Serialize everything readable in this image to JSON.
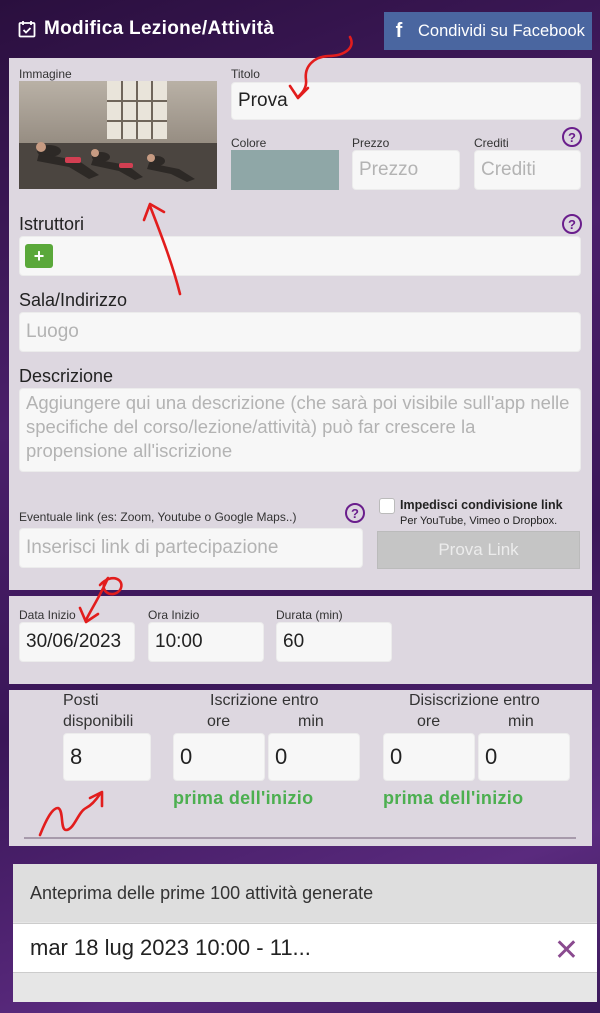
{
  "header": {
    "title": "Modifica Lezione/Attività",
    "facebook_button": "Condividi su Facebook",
    "facebook_glyph": "f"
  },
  "form": {
    "image_label": "Immagine",
    "title_label": "Titolo",
    "title_value": "Prova",
    "color_label": "Colore",
    "color_value": "#8fa7a7",
    "price_label": "Prezzo",
    "price_placeholder": "Prezzo",
    "credits_label": "Crediti",
    "credits_placeholder": "Crediti",
    "help_glyph": "?",
    "instructors_label": "Istruttori",
    "add_glyph": "+",
    "room_label": "Sala/Indirizzo",
    "room_placeholder": "Luogo",
    "description_label": "Descrizione",
    "description_placeholder": "Aggiungere qui una descrizione (che sarà poi visibile sull'app nelle specifiche del corso/lezione/attività) può far crescere la propensione all'iscrizione",
    "link_label": "Eventuale link (es: Zoom, Youtube o Google Maps..)",
    "link_placeholder": "Inserisci link di partecipazione",
    "block_share_label": "Impedisci condivisione link",
    "block_share_sub": "Per YouTube, Vimeo o Dropbox.",
    "test_link_button": "Prova Link"
  },
  "schedule": {
    "start_date_label": "Data Inizio",
    "start_date_value": "30/06/2023",
    "start_time_label": "Ora Inizio",
    "start_time_value": "10:00",
    "duration_label": "Durata (min)",
    "duration_value": "60"
  },
  "booking": {
    "seats_label_1": "Posti",
    "seats_label_2": "disponibili",
    "seats_value": "8",
    "signup_title": "Iscrizione entro",
    "signup_hours_label": "ore",
    "signup_min_label": "min",
    "signup_hours_value": "0",
    "signup_min_value": "0",
    "signup_note": "prima dell'inizio",
    "cancel_title": "Disiscrizione entro",
    "cancel_hours_label": "ore",
    "cancel_min_label": "min",
    "cancel_hours_value": "0",
    "cancel_min_value": "0",
    "cancel_note": "prima dell'inizio"
  },
  "preview": {
    "header": "Anteprima delle prime 100 attività generate",
    "rows": [
      {
        "text": "mar 18 lug 2023 10:00 - 11..."
      }
    ],
    "remove_glyph": "✕"
  },
  "icons": {
    "title_icon": "calendar-check-icon",
    "facebook_icon": "facebook-icon",
    "help_icon": "question-circle-icon",
    "add_icon": "plus-icon",
    "remove_icon": "close-icon"
  },
  "colors": {
    "panel": "#ddd7e0",
    "facebook": "#4a66a0",
    "accent_purple": "#6a1e8c",
    "green": "#5aa83a",
    "note_green": "#4caf50",
    "annotation_red": "#e21d1d"
  }
}
